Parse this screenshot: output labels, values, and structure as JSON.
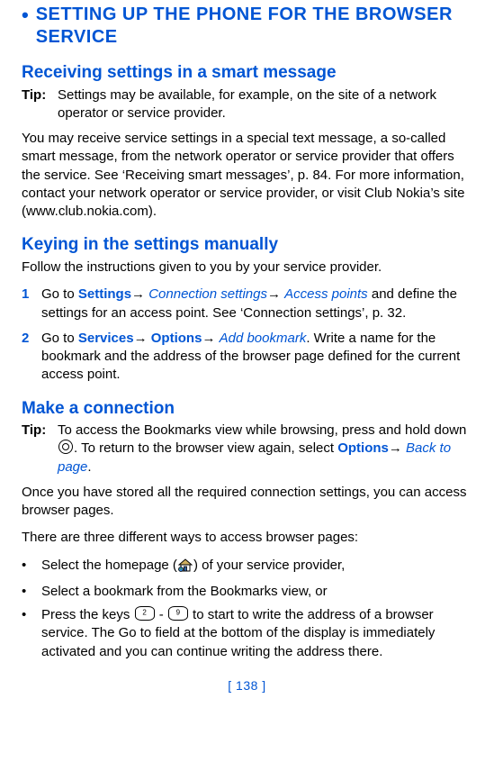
{
  "h1": "SETTING UP THE PHONE FOR THE BROWSER SERVICE",
  "sec1": {
    "title": "Receiving settings in a smart message",
    "tipLabel": "Tip:",
    "tipBody": "Settings may be available, for example, on the site of a network operator or service provider.",
    "para": "You may receive service settings in a special text message, a so-called smart message, from the network operator or service provider that offers the service. See ‘Receiving smart messages’, p. 84. For more information, contact your network operator or service provider, or visit Club Nokia’s site (www.club.nokia.com)."
  },
  "sec2": {
    "title": "Keying in the settings manually",
    "intro": "Follow the instructions given to you by your service provider.",
    "step1": {
      "num": "1",
      "pre": "Go to ",
      "a": "Settings",
      "b": "Connection settings",
      "c": "Access points",
      "post": " and define the settings for an access point. See ‘Connection settings’, p. 32."
    },
    "step2": {
      "num": "2",
      "pre": "Go to ",
      "a": "Services",
      "b": "Options",
      "c": "Add bookmark",
      "post": ". Write a name for the bookmark and the address of the browser page defined for the current access point."
    }
  },
  "sec3": {
    "title": "Make a connection",
    "tipLabel": "Tip:",
    "tipPre": "To access the Bookmarks view while browsing, press and hold down ",
    "tipMid": ". To return to the browser view again, select ",
    "tipA": "Options",
    "tipB": "Back to page",
    "tipPost": ".",
    "para1": "Once you have stored all the required connection settings, you can access browser pages.",
    "para2": "There are three different ways to access browser pages:",
    "b1pre": "Select the homepage (",
    "b1post": ") of your service provider,",
    "b2": "Select a bookmark from the Bookmarks view, or",
    "b3pre": "Press the keys ",
    "b3mid": " - ",
    "b3post": " to start to write the address of a browser service. The Go to field at the bottom of the display is immediately activated and you can continue writing the address there."
  },
  "arrow": "→",
  "bullet": "•",
  "footer": "[ 138 ]"
}
